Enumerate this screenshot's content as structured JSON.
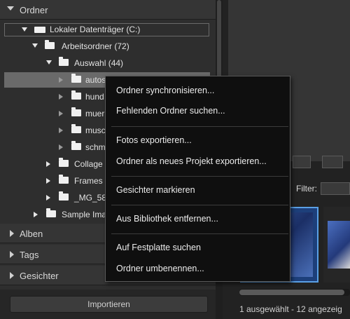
{
  "sections": {
    "ordner": "Ordner",
    "alben": "Alben",
    "tags": "Tags",
    "gesichter": "Gesichter"
  },
  "tree": {
    "drive": "Lokaler Datenträger (C:)",
    "arbeitsordner": "Arbeitsordner (72)",
    "auswahl": "Auswahl (44)",
    "autos": "autos",
    "hund": "hund",
    "muer": "muer",
    "musch": "musch",
    "schm": "schm",
    "collage": "Collage",
    "frames": "Frames",
    "mg58": "_MG_58",
    "sample": "Sample Ima"
  },
  "import_button": "Importieren",
  "filter_label": "Filter:",
  "status_text": "1 ausgewählt - 12 angezeig",
  "context_menu": {
    "items": [
      "Ordner synchronisieren...",
      "Fehlenden Ordner suchen...",
      "Fotos exportieren...",
      "Ordner als neues Projekt exportieren...",
      "Gesichter markieren",
      "Aus Bibliothek entfernen...",
      "Auf Festplatte suchen",
      "Ordner umbenennen..."
    ]
  },
  "colors": {
    "selection_border": "#5aa0e6",
    "menu_bg": "#0f0f0f",
    "panel_bg": "#2e2e2e"
  }
}
